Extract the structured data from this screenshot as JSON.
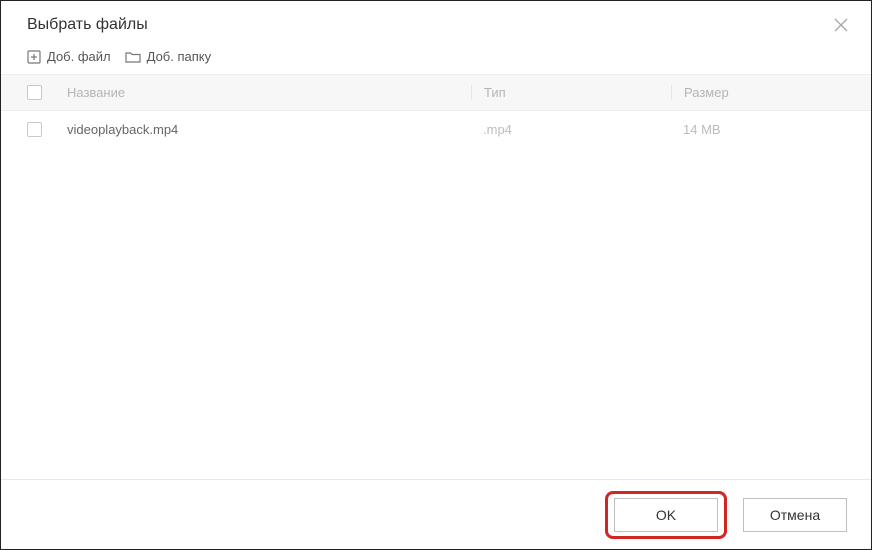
{
  "dialog": {
    "title": "Выбрать файлы"
  },
  "toolbar": {
    "add_file_label": "Доб. файл",
    "add_folder_label": "Доб. папку"
  },
  "columns": {
    "name": "Название",
    "type": "Тип",
    "size": "Размер"
  },
  "rows": [
    {
      "name": "videoplayback.mp4",
      "type": ".mp4",
      "size": "14 MB"
    }
  ],
  "buttons": {
    "ok": "OK",
    "cancel": "Отмена"
  }
}
